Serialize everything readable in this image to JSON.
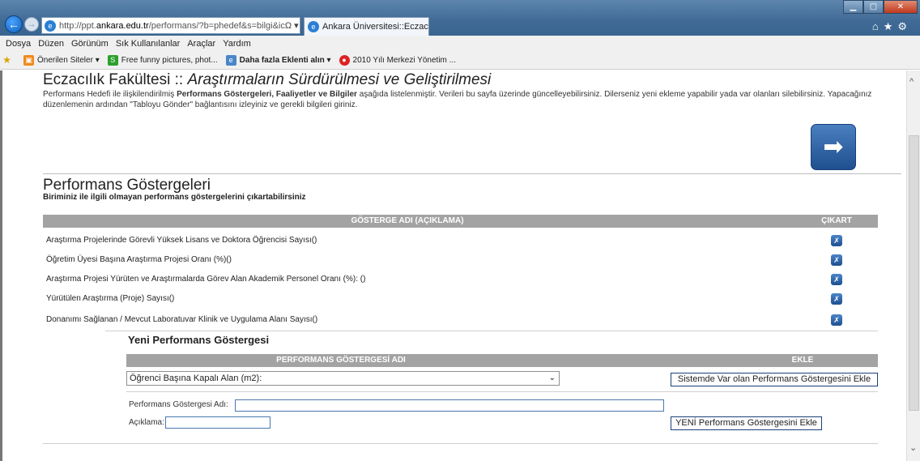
{
  "browser": {
    "url_prefix": "http://ppt.",
    "url_domain": "ankara.edu.tr",
    "url_suffix": "/performans/?b=phedef&s=bilgi&ic",
    "address_tools": "Ω ▾ C",
    "tab_title": "Ankara Üniversitesi::Eczacılı...",
    "menu": [
      "Dosya",
      "Düzen",
      "Görünüm",
      "Sık Kullanılanlar",
      "Araçlar",
      "Yardım"
    ],
    "favorites": [
      {
        "label": "Önerilen Siteler ▾",
        "icon": "suggested-sites-icon",
        "color": "#f08a1c"
      },
      {
        "label": "Free funny pictures, phot...",
        "icon": "site-s-icon",
        "color": "#2ca02c"
      },
      {
        "label": "Daha fazla Eklenti alın ▾",
        "icon": "ie-page-icon",
        "color": "#4a86c8"
      },
      {
        "label": "2010 Yılı Merkezi Yönetim ...",
        "icon": "red-circle-icon",
        "color": "#d22"
      }
    ]
  },
  "header": {
    "title_plain": "Eczacılık Fakültesi :: ",
    "title_italic": "Araştırmaların Sürdürülmesi ve Geliştirilmesi",
    "intro_1": "Performans Hedefi ile ilişkilendirilmiş ",
    "intro_bold": "Performans Göstergeleri, Faaliyetler ve Bilgiler",
    "intro_2": " aşağıda listelenmiştir. Verileri bu sayfa üzerinde güncelleyebilirsiniz. Dilerseniz yeni ekleme yapabilir yada var olanları silebilirsiniz. Yapacağınız düzenlemenin ardından \"Tabloyu Gönder\" bağlantısını izleyiniz ve gerekli bilgileri giriniz."
  },
  "indicators": {
    "title": "Performans Göstergeleri",
    "subtitle": "Biriminiz ile ilgili olmayan performans göstergelerini çıkartabilirsiniz",
    "col_name": "GÖSTERGE ADI (AÇIKLAMA)",
    "col_remove": "ÇIKART",
    "rows": [
      "Araştırma Projelerinde Görevli Yüksek Lisans ve Doktora Öğrencisi Sayısı()",
      "Öğretim Üyesi Başına Araştırma Projesi Oranı (%)()",
      "Araştırma Projesi Yürüten ve Araştırmalarda Görev Alan Akademik Personel Oranı (%): ()",
      "Yürütülen Araştırma (Proje) Sayısı()",
      "Donanımı Sağlanan / Mevcut Laboratuvar Klinik ve Uygulama Alanı Sayısı()"
    ]
  },
  "new_indicator": {
    "title": "Yeni Performans Göstergesi",
    "col_name": "PERFORMANS GÖSTERGESİ ADI",
    "col_add": "EKLE",
    "selected": "Öğrenci Başına Kapalı Alan (m2):",
    "add_existing_label": "Sistemde Var olan Performans Göstergesini Ekle",
    "name_label": "Performans Göstergesi Adı:",
    "desc_label": "Açıklama:",
    "add_new_label": "YENİ Performans Göstergesini Ekle"
  }
}
